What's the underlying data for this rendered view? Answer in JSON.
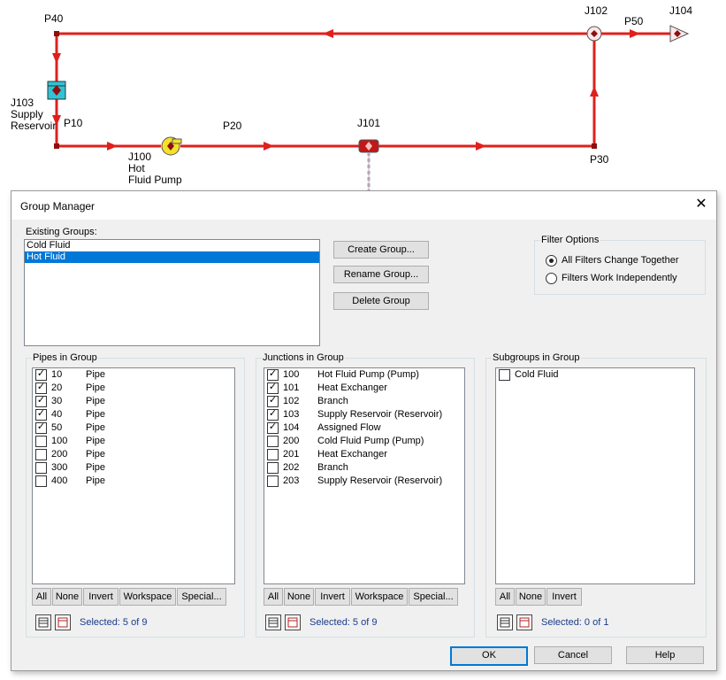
{
  "diagram": {
    "labels": {
      "p40": "P40",
      "j102": "J102",
      "p50": "P50",
      "j104": "J104",
      "j103": "J103\nSupply\nReservoir",
      "p10": "P10",
      "p20": "P20",
      "j101": "J101",
      "j100": "J100\nHot\nFluid Pump",
      "p30": "P30"
    },
    "colors": {
      "pipe": "#e0201c",
      "reservoir": "#2ec4d6",
      "pump": "#f5e12a"
    }
  },
  "dialog": {
    "title": "Group Manager",
    "close_glyph": "✕",
    "existing_groups_label": "Existing Groups:",
    "groups": [
      "Cold Fluid",
      "Hot Fluid"
    ],
    "buttons": {
      "create": "Create Group...",
      "rename": "Rename Group...",
      "delete": "Delete Group"
    },
    "filter": {
      "title": "Filter Options",
      "options": [
        "All Filters Change Together",
        "Filters Work Independently"
      ]
    },
    "pipes": {
      "title": "Pipes in Group",
      "items": [
        {
          "id": "10",
          "type": "Pipe",
          "checked": true
        },
        {
          "id": "20",
          "type": "Pipe",
          "checked": true
        },
        {
          "id": "30",
          "type": "Pipe",
          "checked": true
        },
        {
          "id": "40",
          "type": "Pipe",
          "checked": true
        },
        {
          "id": "50",
          "type": "Pipe",
          "checked": true
        },
        {
          "id": "100",
          "type": "Pipe",
          "checked": false
        },
        {
          "id": "200",
          "type": "Pipe",
          "checked": false
        },
        {
          "id": "300",
          "type": "Pipe",
          "checked": false
        },
        {
          "id": "400",
          "type": "Pipe",
          "checked": false
        }
      ],
      "actions": [
        "All",
        "None",
        "Invert",
        "Workspace",
        "Special..."
      ],
      "selected": "Selected: 5 of 9"
    },
    "junctions": {
      "title": "Junctions in Group",
      "items": [
        {
          "id": "100",
          "type": "Hot Fluid Pump (Pump)",
          "checked": true
        },
        {
          "id": "101",
          "type": "Heat Exchanger",
          "checked": true
        },
        {
          "id": "102",
          "type": "Branch",
          "checked": true
        },
        {
          "id": "103",
          "type": "Supply Reservoir (Reservoir)",
          "checked": true
        },
        {
          "id": "104",
          "type": "Assigned Flow",
          "checked": true
        },
        {
          "id": "200",
          "type": "Cold Fluid Pump (Pump)",
          "checked": false
        },
        {
          "id": "201",
          "type": "Heat Exchanger",
          "checked": false
        },
        {
          "id": "202",
          "type": "Branch",
          "checked": false
        },
        {
          "id": "203",
          "type": "Supply Reservoir (Reservoir)",
          "checked": false
        }
      ],
      "actions": [
        "All",
        "None",
        "Invert",
        "Workspace",
        "Special..."
      ],
      "selected": "Selected: 5 of 9"
    },
    "subgroups": {
      "title": "Subgroups in Group",
      "items": [
        {
          "name": "Cold Fluid",
          "checked": false
        }
      ],
      "actions": [
        "All",
        "None",
        "Invert"
      ],
      "selected": "Selected: 0 of 1"
    },
    "footer": {
      "ok": "OK",
      "cancel": "Cancel",
      "help": "Help"
    }
  }
}
